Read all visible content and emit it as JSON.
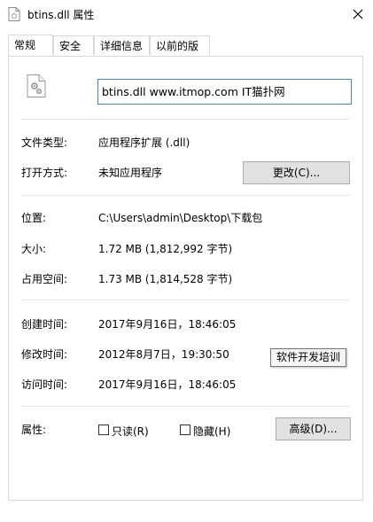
{
  "window": {
    "title": "btins.dll 属性"
  },
  "tabs": [
    {
      "label": "常规"
    },
    {
      "label": "安全"
    },
    {
      "label": "详细信息"
    },
    {
      "label": "以前的版本"
    }
  ],
  "file": {
    "name_value": "btins.dll www.itmop.com IT猫扑网"
  },
  "type": {
    "label": "文件类型:",
    "value": "应用程序扩展 (.dll)"
  },
  "open_with": {
    "label": "打开方式:",
    "value": "未知应用程序",
    "change_button": "更改(C)..."
  },
  "location": {
    "label": "位置:",
    "value": "C:\\Users\\admin\\Desktop\\下载包"
  },
  "size": {
    "label": "大小:",
    "value": "1.72 MB (1,812,992 字节)"
  },
  "size_on_disk": {
    "label": "占用空间:",
    "value": "1.73 MB (1,814,528 字节)"
  },
  "created": {
    "label": "创建时间:",
    "value": "2017年9月16日，18:46:05"
  },
  "modified": {
    "label": "修改时间:",
    "value": "2012年8月7日，19:30:50"
  },
  "accessed": {
    "label": "访问时间:",
    "value": "2017年9月16日，18:46:05"
  },
  "tooltip": {
    "text": "软件开发培训"
  },
  "attributes": {
    "label": "属性:",
    "readonly_label": "只读(R)",
    "hidden_label": "隐藏(H)",
    "advanced_button": "高级(D)..."
  },
  "icons": {
    "file": "dll-gear-icon",
    "title": "file-icon",
    "close": "close-icon"
  },
  "colors": {
    "input_border": "#4a83c9",
    "button_bg": "#e1e1e1",
    "divider": "#e3e3e3"
  }
}
